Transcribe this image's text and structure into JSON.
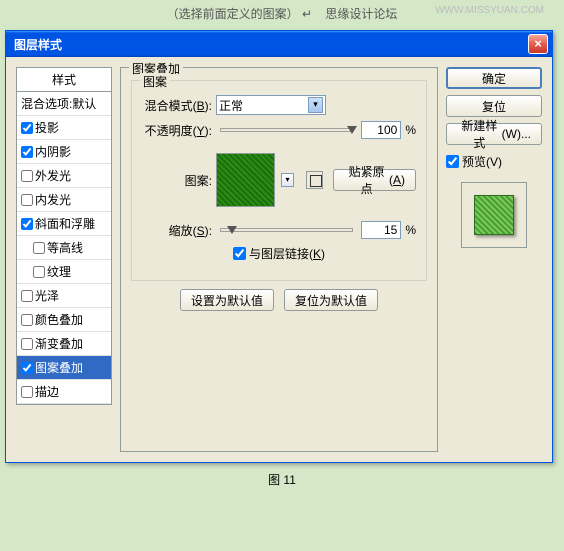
{
  "header": {
    "note": "（选择前面定义的图案）",
    "arrow": "↵",
    "forum": "思缘设计论坛",
    "watermark": "WWW.MISSYUAN.COM"
  },
  "dialog": {
    "title": "图层样式"
  },
  "styles": {
    "header": "样式",
    "blendDefault": "混合选项:默认",
    "items": [
      {
        "label": "投影",
        "checked": true,
        "indent": false
      },
      {
        "label": "内阴影",
        "checked": true,
        "indent": false
      },
      {
        "label": "外发光",
        "checked": false,
        "indent": false
      },
      {
        "label": "内发光",
        "checked": false,
        "indent": false
      },
      {
        "label": "斜面和浮雕",
        "checked": true,
        "indent": false
      },
      {
        "label": "等高线",
        "checked": false,
        "indent": true
      },
      {
        "label": "纹理",
        "checked": false,
        "indent": true
      },
      {
        "label": "光泽",
        "checked": false,
        "indent": false
      },
      {
        "label": "颜色叠加",
        "checked": false,
        "indent": false
      },
      {
        "label": "渐变叠加",
        "checked": false,
        "indent": false
      },
      {
        "label": "图案叠加",
        "checked": true,
        "indent": false,
        "selected": true
      },
      {
        "label": "描边",
        "checked": false,
        "indent": false
      }
    ]
  },
  "overlay": {
    "groupTitle": "图案叠加",
    "sectionTitle": "图案",
    "blendModeLabel": "混合模式",
    "blendModeKey": "B",
    "blendModeValue": "正常",
    "opacityLabel": "不透明度",
    "opacityKey": "Y",
    "opacityValue": "100",
    "opacityUnit": "%",
    "patternLabel": "图案:",
    "snapLabel": "贴紧原点",
    "snapKey": "A",
    "scaleLabel": "缩放",
    "scaleKey": "S",
    "scaleValue": "15",
    "scaleUnit": "%",
    "linkLabel": "与图层链接",
    "linkKey": "K",
    "setDefault": "设置为默认值",
    "resetDefault": "复位为默认值"
  },
  "buttons": {
    "ok": "确定",
    "cancel": "复位",
    "newStyle": "新建样式",
    "newStyleKey": "W",
    "newStyleSuffix": "...",
    "preview": "预览",
    "previewKey": "V"
  },
  "caption": "图 11"
}
